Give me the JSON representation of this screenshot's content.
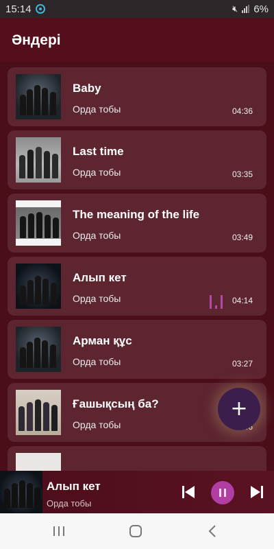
{
  "status_bar": {
    "time": "15:14",
    "battery": "6%"
  },
  "header": {
    "title": "Әндері"
  },
  "songs": [
    {
      "title": "Baby",
      "artist": "Орда тобы",
      "duration": "04:36"
    },
    {
      "title": "Last time",
      "artist": "Орда тобы",
      "duration": "03:35"
    },
    {
      "title": "The meaning of the life",
      "artist": "Орда тобы",
      "duration": "03:49"
    },
    {
      "title": "Алып кет",
      "artist": "Орда тобы",
      "duration": "04:14",
      "playing": true
    },
    {
      "title": "Арман құс",
      "artist": "Орда тобы",
      "duration": "03:27"
    },
    {
      "title": "Ғашықсың ба?",
      "artist": "Орда тобы",
      "duration": "03:46"
    }
  ],
  "fab": {
    "icon": "plus-icon"
  },
  "player": {
    "title": "Алып кет",
    "artist": "Орда тобы",
    "state": "playing"
  },
  "icons": {
    "status": [
      "app-icon",
      "mute-icon",
      "signal-icon"
    ],
    "player": [
      "previous-icon",
      "pause-icon",
      "next-icon"
    ],
    "nav": [
      "recent-apps-icon",
      "home-icon",
      "back-icon"
    ]
  },
  "colors": {
    "background": "#4a0e19",
    "card": "#5d2530",
    "accent": "#b13ea3",
    "fab": "#3c1e4c"
  }
}
